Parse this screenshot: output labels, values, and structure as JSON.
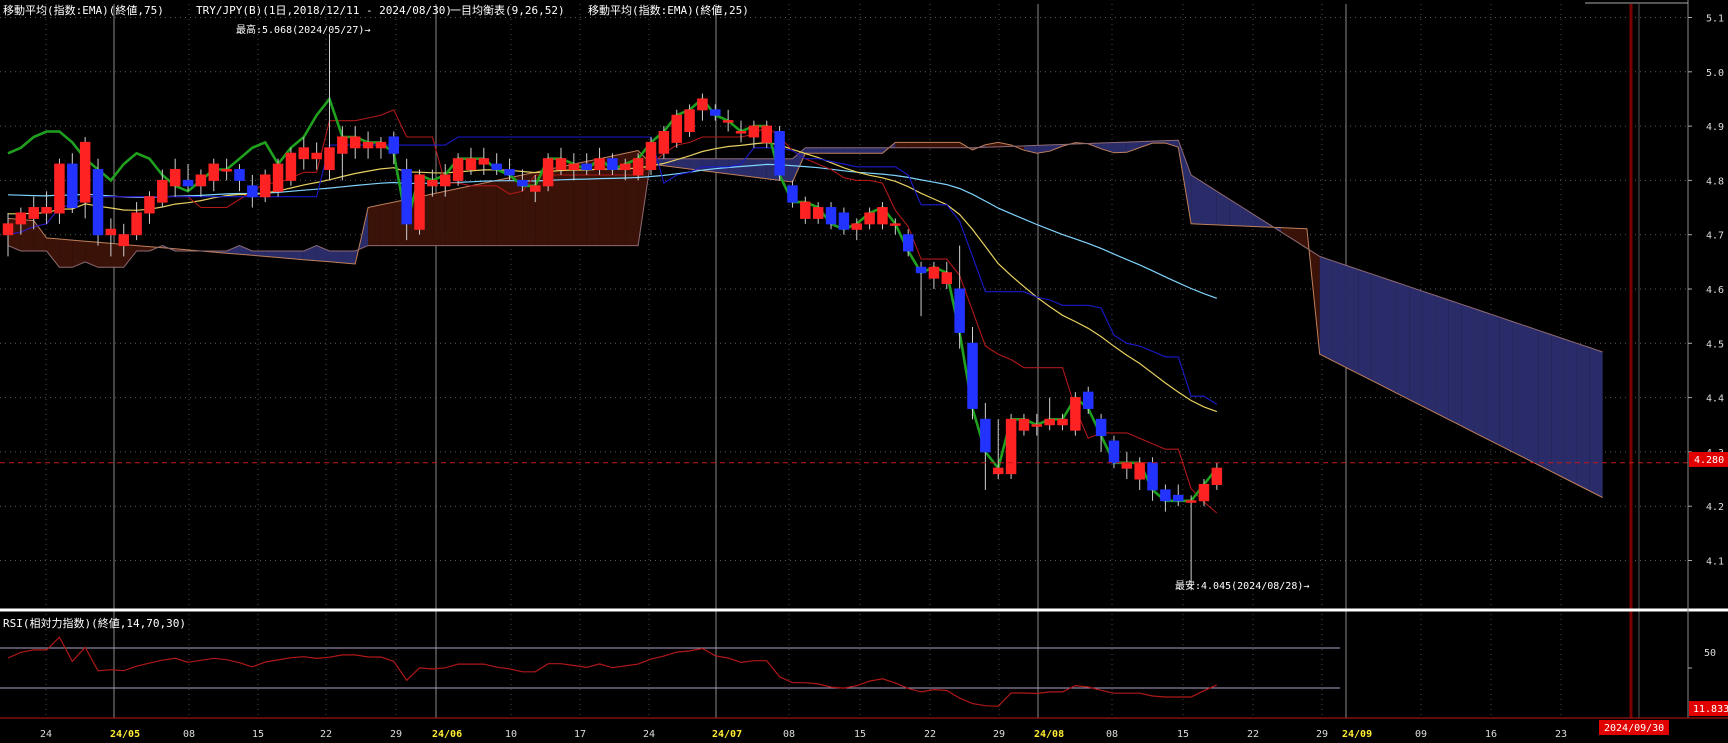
{
  "header": {
    "ema75_label": "移動平均(指数:EMA)(終値,75)",
    "symbol_label": "TRY/JPY(B)(1日,2018/12/11 - 2024/08/30)",
    "ichimoku_label": "一目均衡表(9,26,52)",
    "ema25_label": "移動平均(指数:EMA)(終値,25)"
  },
  "rsi_panel": {
    "label": "RSI(相対力指数)(終値,14,70,30)",
    "tick_50": "50",
    "current_value": "11.833"
  },
  "annotations": {
    "high": "最高:5.068(2024/05/27)→",
    "low": "最安:4.045(2024/08/28)→"
  },
  "price_axis": {
    "ticks": [
      "5.1",
      "5.0",
      "4.9",
      "4.8",
      "4.7",
      "4.6",
      "4.5",
      "4.4",
      "4.3",
      "4.2",
      "4.1"
    ],
    "current_price": "4.280"
  },
  "date_axis": {
    "labels": [
      "24",
      "24/05",
      "08",
      "15",
      "22",
      "29",
      "24/06",
      "10",
      "17",
      "24",
      "24/07",
      "08",
      "15",
      "22",
      "29",
      "24/08",
      "08",
      "15",
      "22",
      "29",
      "24/09",
      "09",
      "16",
      "23"
    ],
    "current_date": "2024/09/30"
  },
  "colors": {
    "up": "#ff2222",
    "down": "#2233ff",
    "ema75": "#7fd4ff",
    "ema25": "#e8d060",
    "tenkan": "#b01818",
    "kijun": "#1a1acc",
    "chikou": "#1fa01f",
    "kumo_bull": "#3a1208",
    "kumo_bear": "#2a2c6a",
    "rsi": "#b01818"
  },
  "chart_data": {
    "type": "candlestick",
    "y_range": [
      4.0,
      5.1
    ],
    "candles": [
      {
        "d": "04-22",
        "o": 4.7,
        "h": 4.74,
        "l": 4.66,
        "c": 4.72
      },
      {
        "d": "04-23",
        "o": 4.72,
        "h": 4.75,
        "l": 4.7,
        "c": 4.74
      },
      {
        "d": "04-24",
        "o": 4.73,
        "h": 4.77,
        "l": 4.71,
        "c": 4.75
      },
      {
        "d": "04-25",
        "o": 4.74,
        "h": 4.78,
        "l": 4.72,
        "c": 4.75
      },
      {
        "d": "04-26",
        "o": 4.74,
        "h": 4.84,
        "l": 4.72,
        "c": 4.83
      },
      {
        "d": "04-29",
        "o": 4.83,
        "h": 4.85,
        "l": 4.74,
        "c": 4.75
      },
      {
        "d": "04-30",
        "o": 4.76,
        "h": 4.88,
        "l": 4.73,
        "c": 4.87
      },
      {
        "d": "05-01",
        "o": 4.82,
        "h": 4.84,
        "l": 4.68,
        "c": 4.7
      },
      {
        "d": "05-02",
        "o": 4.7,
        "h": 4.73,
        "l": 4.66,
        "c": 4.71
      },
      {
        "d": "05-03",
        "o": 4.68,
        "h": 4.72,
        "l": 4.66,
        "c": 4.7
      },
      {
        "d": "05-06",
        "o": 4.7,
        "h": 4.76,
        "l": 4.69,
        "c": 4.74
      },
      {
        "d": "05-07",
        "o": 4.74,
        "h": 4.78,
        "l": 4.72,
        "c": 4.77
      },
      {
        "d": "05-08",
        "o": 4.76,
        "h": 4.82,
        "l": 4.75,
        "c": 4.8
      },
      {
        "d": "05-09",
        "o": 4.79,
        "h": 4.84,
        "l": 4.77,
        "c": 4.82
      },
      {
        "d": "05-10",
        "o": 4.8,
        "h": 4.83,
        "l": 4.78,
        "c": 4.79
      },
      {
        "d": "05-13",
        "o": 4.79,
        "h": 4.82,
        "l": 4.77,
        "c": 4.81
      },
      {
        "d": "05-14",
        "o": 4.8,
        "h": 4.84,
        "l": 4.78,
        "c": 4.83
      },
      {
        "d": "05-15",
        "o": 4.82,
        "h": 4.84,
        "l": 4.8,
        "c": 4.82
      },
      {
        "d": "05-16",
        "o": 4.82,
        "h": 4.83,
        "l": 4.78,
        "c": 4.8
      },
      {
        "d": "05-17",
        "o": 4.79,
        "h": 4.81,
        "l": 4.75,
        "c": 4.77
      },
      {
        "d": "05-20",
        "o": 4.77,
        "h": 4.82,
        "l": 4.76,
        "c": 4.81
      },
      {
        "d": "05-21",
        "o": 4.78,
        "h": 4.84,
        "l": 4.77,
        "c": 4.83
      },
      {
        "d": "05-22",
        "o": 4.8,
        "h": 4.86,
        "l": 4.79,
        "c": 4.85
      },
      {
        "d": "05-23",
        "o": 4.84,
        "h": 4.88,
        "l": 4.82,
        "c": 4.86
      },
      {
        "d": "05-24",
        "o": 4.84,
        "h": 4.87,
        "l": 4.82,
        "c": 4.85
      },
      {
        "d": "05-27",
        "o": 4.82,
        "h": 5.07,
        "l": 4.8,
        "c": 4.86
      },
      {
        "d": "05-28",
        "o": 4.85,
        "h": 4.9,
        "l": 4.8,
        "c": 4.88
      },
      {
        "d": "05-29",
        "o": 4.86,
        "h": 4.9,
        "l": 4.84,
        "c": 4.88
      },
      {
        "d": "05-30",
        "o": 4.86,
        "h": 4.89,
        "l": 4.84,
        "c": 4.87
      },
      {
        "d": "05-31",
        "o": 4.86,
        "h": 4.88,
        "l": 4.84,
        "c": 4.87
      },
      {
        "d": "06-03",
        "o": 4.88,
        "h": 4.89,
        "l": 4.83,
        "c": 4.85
      },
      {
        "d": "06-04",
        "o": 4.82,
        "h": 4.84,
        "l": 4.69,
        "c": 4.72
      },
      {
        "d": "06-05",
        "o": 4.71,
        "h": 4.82,
        "l": 4.7,
        "c": 4.81
      },
      {
        "d": "06-06",
        "o": 4.79,
        "h": 4.82,
        "l": 4.77,
        "c": 4.8
      },
      {
        "d": "06-07",
        "o": 4.79,
        "h": 4.83,
        "l": 4.77,
        "c": 4.81
      },
      {
        "d": "06-10",
        "o": 4.8,
        "h": 4.85,
        "l": 4.79,
        "c": 4.84
      },
      {
        "d": "06-11",
        "o": 4.82,
        "h": 4.86,
        "l": 4.81,
        "c": 4.84
      },
      {
        "d": "06-12",
        "o": 4.83,
        "h": 4.86,
        "l": 4.81,
        "c": 4.84
      },
      {
        "d": "06-13",
        "o": 4.83,
        "h": 4.85,
        "l": 4.81,
        "c": 4.82
      },
      {
        "d": "06-14",
        "o": 4.82,
        "h": 4.84,
        "l": 4.8,
        "c": 4.81
      },
      {
        "d": "06-17",
        "o": 4.8,
        "h": 4.82,
        "l": 4.78,
        "c": 4.79
      },
      {
        "d": "06-18",
        "o": 4.78,
        "h": 4.81,
        "l": 4.76,
        "c": 4.79
      },
      {
        "d": "06-19",
        "o": 4.79,
        "h": 4.85,
        "l": 4.78,
        "c": 4.84
      },
      {
        "d": "06-20",
        "o": 4.82,
        "h": 4.86,
        "l": 4.81,
        "c": 4.84
      },
      {
        "d": "06-21",
        "o": 4.82,
        "h": 4.85,
        "l": 4.8,
        "c": 4.83
      },
      {
        "d": "06-24",
        "o": 4.83,
        "h": 4.85,
        "l": 4.81,
        "c": 4.82
      },
      {
        "d": "06-25",
        "o": 4.82,
        "h": 4.86,
        "l": 4.81,
        "c": 4.84
      },
      {
        "d": "06-26",
        "o": 4.84,
        "h": 4.85,
        "l": 4.81,
        "c": 4.82
      },
      {
        "d": "06-27",
        "o": 4.82,
        "h": 4.84,
        "l": 4.8,
        "c": 4.83
      },
      {
        "d": "06-28",
        "o": 4.81,
        "h": 4.85,
        "l": 4.8,
        "c": 4.84
      },
      {
        "d": "07-01",
        "o": 4.82,
        "h": 4.88,
        "l": 4.81,
        "c": 4.87
      },
      {
        "d": "07-02",
        "o": 4.85,
        "h": 4.9,
        "l": 4.84,
        "c": 4.89
      },
      {
        "d": "07-03",
        "o": 4.87,
        "h": 4.93,
        "l": 4.86,
        "c": 4.92
      },
      {
        "d": "07-04",
        "o": 4.89,
        "h": 4.94,
        "l": 4.88,
        "c": 4.93
      },
      {
        "d": "07-05",
        "o": 4.93,
        "h": 4.96,
        "l": 4.91,
        "c": 4.95
      },
      {
        "d": "07-08",
        "o": 4.93,
        "h": 4.94,
        "l": 4.91,
        "c": 4.92
      },
      {
        "d": "07-09",
        "o": 4.91,
        "h": 4.93,
        "l": 4.89,
        "c": 4.91
      },
      {
        "d": "07-10",
        "o": 4.89,
        "h": 4.91,
        "l": 4.87,
        "c": 4.89
      },
      {
        "d": "07-11",
        "o": 4.88,
        "h": 4.91,
        "l": 4.86,
        "c": 4.9
      },
      {
        "d": "07-12",
        "o": 4.87,
        "h": 4.91,
        "l": 4.86,
        "c": 4.9
      },
      {
        "d": "07-15",
        "o": 4.89,
        "h": 4.9,
        "l": 4.8,
        "c": 4.81
      },
      {
        "d": "07-16",
        "o": 4.79,
        "h": 4.8,
        "l": 4.75,
        "c": 4.76
      },
      {
        "d": "07-17",
        "o": 4.73,
        "h": 4.77,
        "l": 4.72,
        "c": 4.76
      },
      {
        "d": "07-18",
        "o": 4.73,
        "h": 4.76,
        "l": 4.72,
        "c": 4.75
      },
      {
        "d": "07-19",
        "o": 4.75,
        "h": 4.76,
        "l": 4.71,
        "c": 4.72
      },
      {
        "d": "07-22",
        "o": 4.74,
        "h": 4.75,
        "l": 4.7,
        "c": 4.71
      },
      {
        "d": "07-23",
        "o": 4.71,
        "h": 4.73,
        "l": 4.69,
        "c": 4.72
      },
      {
        "d": "07-24",
        "o": 4.72,
        "h": 4.75,
        "l": 4.71,
        "c": 4.74
      },
      {
        "d": "07-25",
        "o": 4.72,
        "h": 4.76,
        "l": 4.71,
        "c": 4.75
      },
      {
        "d": "07-26",
        "o": 4.72,
        "h": 4.73,
        "l": 4.7,
        "c": 4.72
      },
      {
        "d": "07-29",
        "o": 4.7,
        "h": 4.71,
        "l": 4.66,
        "c": 4.67
      },
      {
        "d": "07-30",
        "o": 4.64,
        "h": 4.65,
        "l": 4.55,
        "c": 4.63
      },
      {
        "d": "07-31",
        "o": 4.62,
        "h": 4.65,
        "l": 4.6,
        "c": 4.64
      },
      {
        "d": "08-01",
        "o": 4.61,
        "h": 4.65,
        "l": 4.6,
        "c": 4.63
      },
      {
        "d": "08-02",
        "o": 4.6,
        "h": 4.68,
        "l": 4.49,
        "c": 4.52
      },
      {
        "d": "08-05",
        "o": 4.5,
        "h": 4.53,
        "l": 4.36,
        "c": 4.38
      },
      {
        "d": "08-06",
        "o": 4.36,
        "h": 4.39,
        "l": 4.23,
        "c": 4.3
      },
      {
        "d": "08-07",
        "o": 4.26,
        "h": 4.36,
        "l": 4.25,
        "c": 4.27
      },
      {
        "d": "08-08",
        "o": 4.26,
        "h": 4.37,
        "l": 4.25,
        "c": 4.36
      },
      {
        "d": "08-09",
        "o": 4.34,
        "h": 4.37,
        "l": 4.33,
        "c": 4.36
      },
      {
        "d": "08-12",
        "o": 4.35,
        "h": 4.37,
        "l": 4.33,
        "c": 4.35
      },
      {
        "d": "08-13",
        "o": 4.35,
        "h": 4.4,
        "l": 4.34,
        "c": 4.36
      },
      {
        "d": "08-14",
        "o": 4.35,
        "h": 4.37,
        "l": 4.34,
        "c": 4.36
      },
      {
        "d": "08-15",
        "o": 4.34,
        "h": 4.41,
        "l": 4.33,
        "c": 4.4
      },
      {
        "d": "08-16",
        "o": 4.41,
        "h": 4.42,
        "l": 4.37,
        "c": 4.38
      },
      {
        "d": "08-19",
        "o": 4.36,
        "h": 4.37,
        "l": 4.3,
        "c": 4.33
      },
      {
        "d": "08-20",
        "o": 4.32,
        "h": 4.33,
        "l": 4.27,
        "c": 4.28
      },
      {
        "d": "08-21",
        "o": 4.27,
        "h": 4.3,
        "l": 4.25,
        "c": 4.28
      },
      {
        "d": "08-22",
        "o": 4.25,
        "h": 4.29,
        "l": 4.23,
        "c": 4.28
      },
      {
        "d": "08-23",
        "o": 4.28,
        "h": 4.29,
        "l": 4.21,
        "c": 4.23
      },
      {
        "d": "08-26",
        "o": 4.23,
        "h": 4.24,
        "l": 4.19,
        "c": 4.21
      },
      {
        "d": "08-27",
        "o": 4.22,
        "h": 4.24,
        "l": 4.2,
        "c": 4.21
      },
      {
        "d": "08-28",
        "o": 4.21,
        "h": 4.22,
        "l": 4.045,
        "c": 4.21
      },
      {
        "d": "08-29",
        "o": 4.21,
        "h": 4.25,
        "l": 4.2,
        "c": 4.24
      },
      {
        "d": "08-30",
        "o": 4.24,
        "h": 4.28,
        "l": 4.23,
        "c": 4.27
      }
    ]
  }
}
